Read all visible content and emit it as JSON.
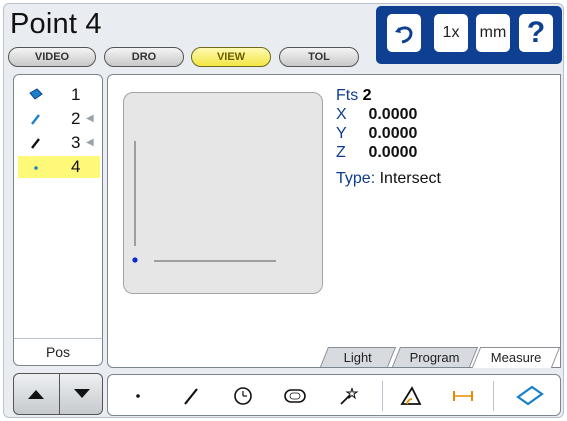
{
  "title": "Point 4",
  "modes": [
    {
      "label": "VIDEO",
      "active": false
    },
    {
      "label": "DRO",
      "active": false
    },
    {
      "label": "VIEW",
      "active": true
    },
    {
      "label": "TOL",
      "active": false
    }
  ],
  "top_buttons": [
    {
      "icon": "undo-icon"
    },
    {
      "label": "1x",
      "icon": "magnification-icon"
    },
    {
      "label": "mm",
      "icon": "units-icon"
    },
    {
      "label": "?",
      "icon": "help-icon"
    }
  ],
  "feature_list": {
    "items": [
      {
        "number": "1",
        "icon": "plane-icon",
        "selected": false
      },
      {
        "number": "2",
        "icon": "line-icon",
        "selected": false
      },
      {
        "number": "3",
        "icon": "line-icon",
        "selected": false
      },
      {
        "number": "4",
        "icon": "point-icon",
        "selected": true
      }
    ],
    "footer_label": "Pos"
  },
  "details": {
    "fts_label": "Fts",
    "fts_value": "2",
    "coords": [
      {
        "axis": "X",
        "value": "0.0000"
      },
      {
        "axis": "Y",
        "value": "0.0000"
      },
      {
        "axis": "Z",
        "value": "0.0000"
      }
    ],
    "type_label": "Type:",
    "type_value": "Intersect"
  },
  "tabs": [
    {
      "label": "Light",
      "active": false
    },
    {
      "label": "Program",
      "active": false
    },
    {
      "label": "Measure",
      "active": true
    }
  ],
  "nav": {
    "up_icon": "up-arrow-icon",
    "down_icon": "down-arrow-icon"
  },
  "tools": [
    "point-tool-icon",
    "line-tool-icon",
    "circle-tool-icon",
    "slot-tool-icon",
    "auto-measure-icon",
    "angle-tool-icon",
    "distance-tool-icon",
    "plane-tool-icon"
  ],
  "colors": {
    "accent_blue": "#0e3f91",
    "active_yellow": "#f3e544",
    "selection_yellow": "#fff97a"
  }
}
